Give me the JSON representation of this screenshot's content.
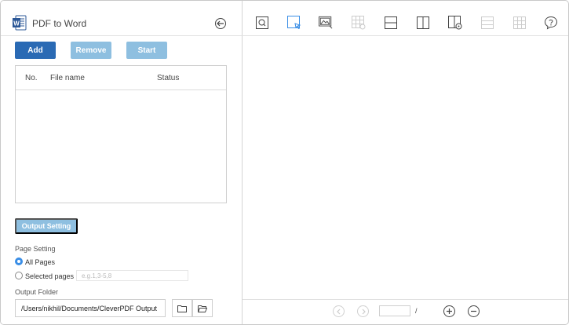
{
  "window": {
    "title": "PDF to Word"
  },
  "actions": {
    "add_label": "Add",
    "remove_label": "Remove",
    "start_label": "Start"
  },
  "file_table": {
    "columns": [
      "No.",
      "File name",
      "Status"
    ],
    "rows": []
  },
  "output_setting": {
    "button_label": "Output Setting"
  },
  "page_setting": {
    "label": "Page Setting",
    "all_pages_label": "All Pages",
    "selected_pages_label": "Selected pages",
    "selected_pages_placeholder": "e.g.1,3-5,8",
    "selected": "All Pages"
  },
  "output_folder": {
    "label": "Output Folder",
    "path": "/Users/nikhil/Documents/CleverPDF Output"
  },
  "toolbar": {
    "tools": [
      "search-icon",
      "select-icon",
      "image-icon",
      "table-icon",
      "horizontal-split-icon",
      "vertical-split-icon",
      "page-rotate-icon",
      "rows-icon",
      "grid-icon",
      "comment-icon"
    ]
  },
  "pager": {
    "separator": "/"
  },
  "colors": {
    "primary": "#2a6ab4",
    "primary_light": "#8ebfe0",
    "accent": "#3a8ee6"
  }
}
